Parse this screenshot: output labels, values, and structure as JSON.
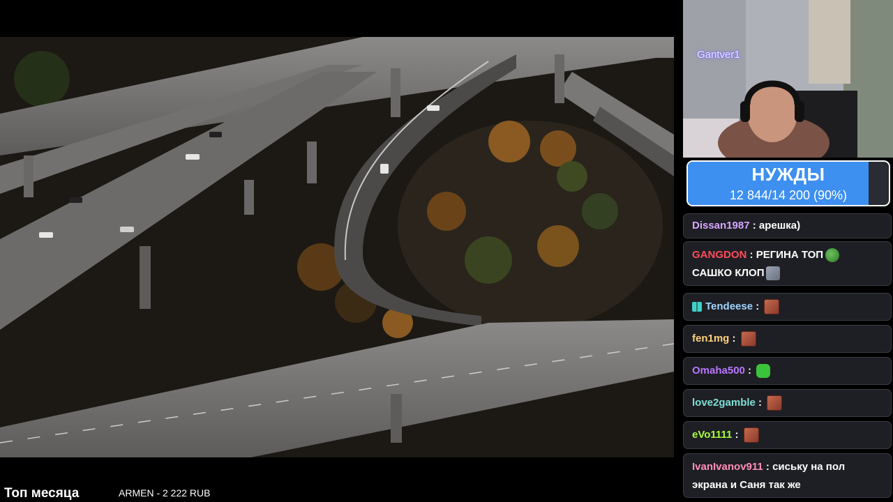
{
  "webcam": {
    "streamer_name": "Gantver1"
  },
  "goal": {
    "title": "НУЖДЫ",
    "progress_text": "12 844/14 200 (90%)",
    "progress_fraction": 0.9,
    "fill_color": "#3d8ff0"
  },
  "chat": {
    "messages": [
      {
        "user": "Dissan1987",
        "user_color": "#d7a6ff",
        "text": "арешка)",
        "emotes": []
      },
      {
        "user": "GANGDON",
        "user_color": "#ff4d5a",
        "text": "РЕГИНА ТОП",
        "text2": "САШКО КЛОП",
        "emotes": [
          "pepe-emote",
          "gray-emote"
        ]
      },
      {
        "user": "Tendeese",
        "user_color": "#9fd3ff",
        "text": "",
        "badge": "badge-icon",
        "emotes": [
          "face-emote"
        ]
      },
      {
        "user": "fen1mg",
        "user_color": "#ffd27a",
        "text": "",
        "emotes": [
          "face-emote"
        ]
      },
      {
        "user": "Omaha500",
        "user_color": "#b877ff",
        "text": "",
        "emotes": [
          "green-emote"
        ]
      },
      {
        "user": "love2gamble",
        "user_color": "#7fe0d6",
        "text": "",
        "emotes": [
          "face-emote"
        ]
      },
      {
        "user": "eVo1111",
        "user_color": "#a8ff3c",
        "text": "",
        "emotes": [
          "face-emote"
        ]
      },
      {
        "user": "IvanIvanov911",
        "user_color": "#ff8fb8",
        "text": "сиську на пол",
        "text2": "экрана и Саня так же",
        "emotes": []
      }
    ]
  },
  "ticker": {
    "title": "Топ месяца",
    "donor": "ARMEN - 2 222 RUB"
  }
}
